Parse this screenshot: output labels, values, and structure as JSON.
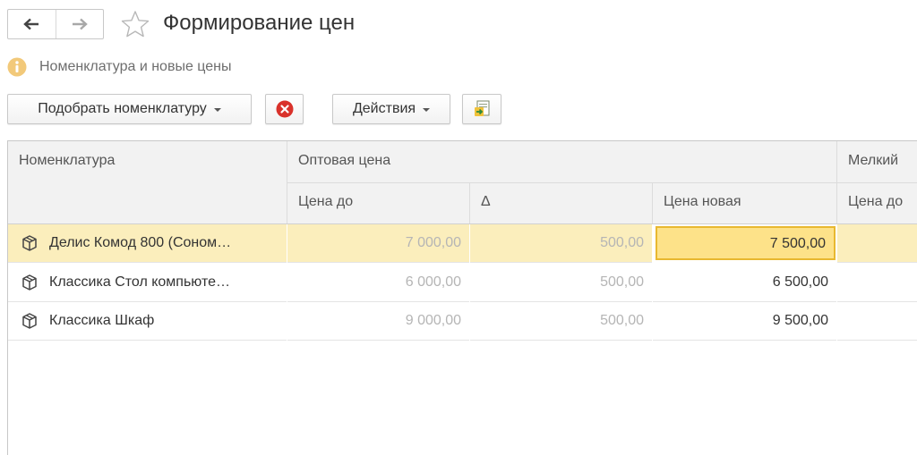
{
  "window": {
    "title": "Формирование цен"
  },
  "info": {
    "text": "Номенклатура и новые цены"
  },
  "toolbar": {
    "select_label": "Подобрать номенклатуру",
    "actions_label": "Действия"
  },
  "table": {
    "headers": {
      "nomenclature": "Номенклатура",
      "wholesale": "Оптовая цена",
      "retail": "Мелкий",
      "price_before": "Цена до",
      "delta": "Δ",
      "price_new": "Цена новая",
      "retail_price_before": "Цена до"
    },
    "rows": [
      {
        "name": "Делис Комод 800 (Соном…",
        "price_before": "7 000,00",
        "delta": "500,00",
        "price_new": "7 500,00"
      },
      {
        "name": "Классика Стол компьюте…",
        "price_before": "6 000,00",
        "delta": "500,00",
        "price_new": "6 500,00"
      },
      {
        "name": "Классика Шкаф",
        "price_before": "9 000,00",
        "delta": "500,00",
        "price_new": "9 500,00"
      }
    ]
  },
  "colors": {
    "selected_row": "#fbeebc",
    "selected_cell": "#fde289",
    "selected_cell_border": "#e8b830",
    "header_bg": "#f2f2f2"
  }
}
